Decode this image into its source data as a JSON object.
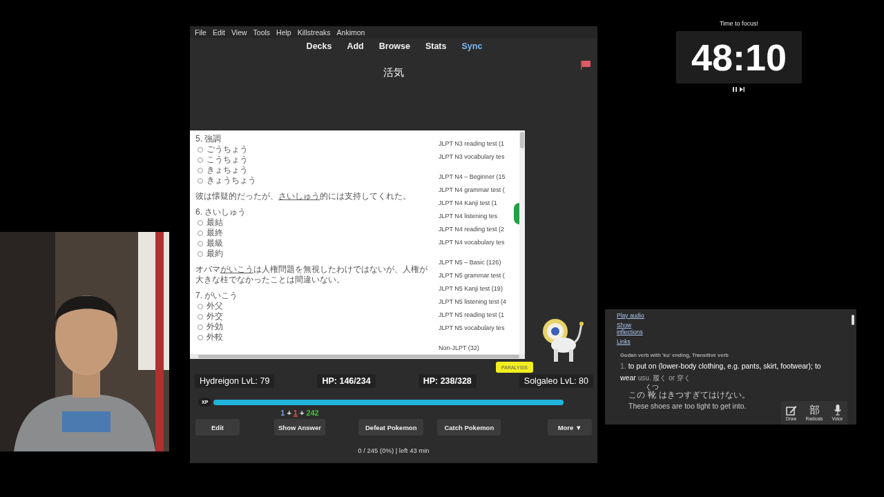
{
  "timer": {
    "label": "Time to focus!",
    "time": "48:10"
  },
  "anki": {
    "menu": [
      "File",
      "Edit",
      "View",
      "Tools",
      "Help",
      "Killstreaks",
      "Ankimon"
    ],
    "nav": [
      {
        "label": "Decks",
        "highlighted": false
      },
      {
        "label": "Add",
        "highlighted": false
      },
      {
        "label": "Browse",
        "highlighted": false
      },
      {
        "label": "Stats",
        "highlighted": false
      },
      {
        "label": "Sync",
        "highlighted": true
      }
    ],
    "card_title": "活気",
    "flagged": true,
    "blocks": [
      {
        "kind": "question",
        "label": "5. 強調",
        "options": [
          {
            "text": "ごうちょう",
            "selected": false
          },
          {
            "text": "こうちょう",
            "selected": false
          },
          {
            "text": "きょちょう",
            "selected": false
          },
          {
            "text": "きょうちょう",
            "selected": false
          }
        ]
      },
      {
        "kind": "sentence",
        "before": "彼は懐疑的だったが、",
        "underlined": "さいしゅう",
        "after": "的には支持してくれた。"
      },
      {
        "kind": "question",
        "label": "6. さいしゅう",
        "options": [
          {
            "text": "最結",
            "selected": false
          },
          {
            "text": "最終",
            "selected": false
          },
          {
            "text": "最級",
            "selected": false
          },
          {
            "text": "最約",
            "selected": false
          }
        ]
      },
      {
        "kind": "sentence",
        "before": "オバマ",
        "underlined": "がいこう",
        "after": "は人権問題を無視したわけではないが、人権が大きな柱でなかったことは間違いない。"
      },
      {
        "kind": "question",
        "label": "7. がいこう",
        "options": [
          {
            "text": "外父",
            "selected": false
          },
          {
            "text": "外交",
            "selected": false
          },
          {
            "text": "外効",
            "selected": false
          },
          {
            "text": "外較",
            "selected": false
          }
        ]
      }
    ],
    "deck_groups": [
      {
        "items": [
          "JLPT N3 reading test (1",
          "JLPT N3 vocabulary tes"
        ]
      },
      {
        "items": [
          "JLPT N4 – Beginner (15",
          "JLPT N4 grammar test (",
          "JLPT N4 Kanji test (1",
          "JLPT N4 listening tes",
          "JLPT N4 reading test (2",
          "JLPT N4 vocabulary tes"
        ]
      },
      {
        "items": [
          "JLPT N5 – Basic (126)",
          "JLPT N5 grammar test (",
          "JLPT N5 Kanji test (19)",
          "JLPT N5 listening test (4",
          "JLPT N5 reading test (1",
          "JLPT N5 vocabulary tes"
        ]
      },
      {
        "items": [
          "Non-JLPT (32)"
        ]
      }
    ],
    "status_badge": "PARALYSIS",
    "stats": [
      "Hydreigon LvL: 79",
      "HP: 146/234",
      "HP: 238/328",
      "Solgaleo LvL: 80"
    ],
    "xp": {
      "label": "XP",
      "level": 1
    },
    "count_separator": "+",
    "counts": [
      {
        "value": "1",
        "color": "#6f9fe0",
        "current": false
      },
      {
        "value": "1",
        "color": "#e05050",
        "current": true
      },
      {
        "value": "242",
        "color": "#40c040",
        "current": false
      }
    ],
    "buttons": [
      "Edit",
      "Show Answer",
      "Defeat Pokemon",
      "Catch Pokemon",
      "More ▼"
    ],
    "footer": "0 / 245 (0%) | left 43 min"
  },
  "dictionary": {
    "links": [
      "Play audio",
      "Show inflections",
      "Links"
    ],
    "part_of_speech": "Godan verb with 'ku' ending, Transitive verb",
    "sense_number": "1.",
    "gloss": "to put on (lower-body clothing, e.g. pants, skirt, footwear); to wear",
    "note": "usu. 履く or 穿く",
    "example": {
      "before": "この",
      "base": "靴",
      "reading": "くつ",
      "after": "はきつすぎてはけない。"
    },
    "translation": "These shoes are too tight to get into.",
    "tools": [
      {
        "glyph": "部",
        "label": "Radicals"
      }
    ],
    "draw_label": "Draw",
    "voice_label": "Voice"
  }
}
